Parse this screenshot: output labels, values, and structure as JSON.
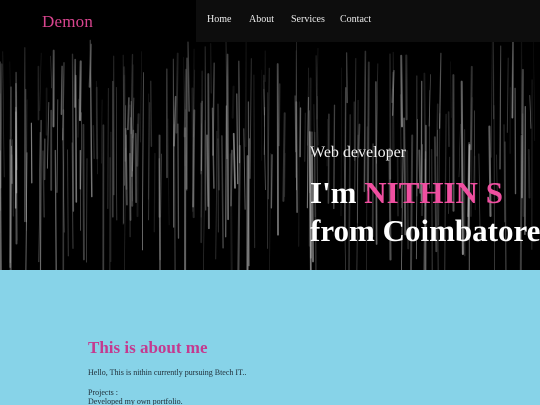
{
  "brand": "Demon",
  "nav": {
    "home": "Home",
    "about": "About",
    "services": "Services",
    "contact": "Contact"
  },
  "hero": {
    "role": "Web developer",
    "intro_prefix": "I'm ",
    "name": "NITHIN S",
    "location_line": "from Coimbatore"
  },
  "about": {
    "title": "This is about me",
    "text": "Hello, This is nithin currently pursuing Btech IT..",
    "projects_label": "Projects :",
    "projects_item": "Developed my own portfolio."
  },
  "colors": {
    "accent": "#ef4fa0",
    "brand": "#d9458f",
    "about_background": "#87d3e8",
    "hero_background": "#000000"
  }
}
